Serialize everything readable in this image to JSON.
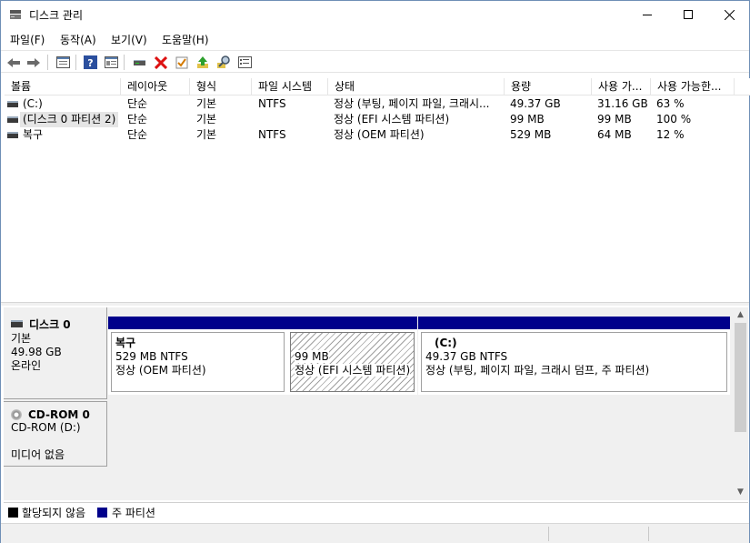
{
  "window": {
    "title": "디스크 관리"
  },
  "menu": [
    "파일(F)",
    "동작(A)",
    "보기(V)",
    "도움말(H)"
  ],
  "toolbar_icons": [
    "back-icon",
    "forward-icon",
    "panel-icon",
    "help-icon",
    "properties-icon",
    "connect-icon",
    "delete-icon",
    "check-icon",
    "up-arrow-icon",
    "search-icon",
    "list-icon"
  ],
  "columns": [
    "볼륨",
    "레이아웃",
    "형식",
    "파일 시스템",
    "상태",
    "용량",
    "사용 가...",
    "사용 가능한..."
  ],
  "volumes": [
    {
      "name": "(C:)",
      "layout": "단순",
      "type": "기본",
      "fs": "NTFS",
      "status": "정상 (부팅, 페이지 파일, 크래시...",
      "capacity": "49.37 GB",
      "free": "31.16 GB",
      "pct": "63 %"
    },
    {
      "name": "(디스크 0 파티션 2)",
      "layout": "단순",
      "type": "기본",
      "fs": "",
      "status": "정상 (EFI 시스템 파티션)",
      "capacity": "99 MB",
      "free": "99 MB",
      "pct": "100 %"
    },
    {
      "name": "복구",
      "layout": "단순",
      "type": "기본",
      "fs": "NTFS",
      "status": "정상 (OEM 파티션)",
      "capacity": "529 MB",
      "free": "64 MB",
      "pct": "12 %"
    }
  ],
  "disks": [
    {
      "name": "디스크 0",
      "line1": "기본",
      "line2": "49.98 GB",
      "line3": "온라인",
      "partitions": [
        {
          "name": "복구",
          "size": "529 MB NTFS",
          "status": "정상 (OEM 파티션)"
        },
        {
          "name": "",
          "size": "99 MB",
          "status": "정상 (EFI 시스템 파티션)"
        },
        {
          "name": "(C:)",
          "size": "49.37 GB NTFS",
          "status": "정상 (부팅, 페이지 파일, 크래시 덤프, 주 파티션)"
        }
      ]
    },
    {
      "name": "CD-ROM 0",
      "line1": "CD-ROM (D:)",
      "line2": "",
      "line3": "미디어 없음"
    }
  ],
  "legend": [
    {
      "label": "할당되지 않음",
      "color": "#000000"
    },
    {
      "label": "주 파티션",
      "color": "#00008b"
    }
  ]
}
